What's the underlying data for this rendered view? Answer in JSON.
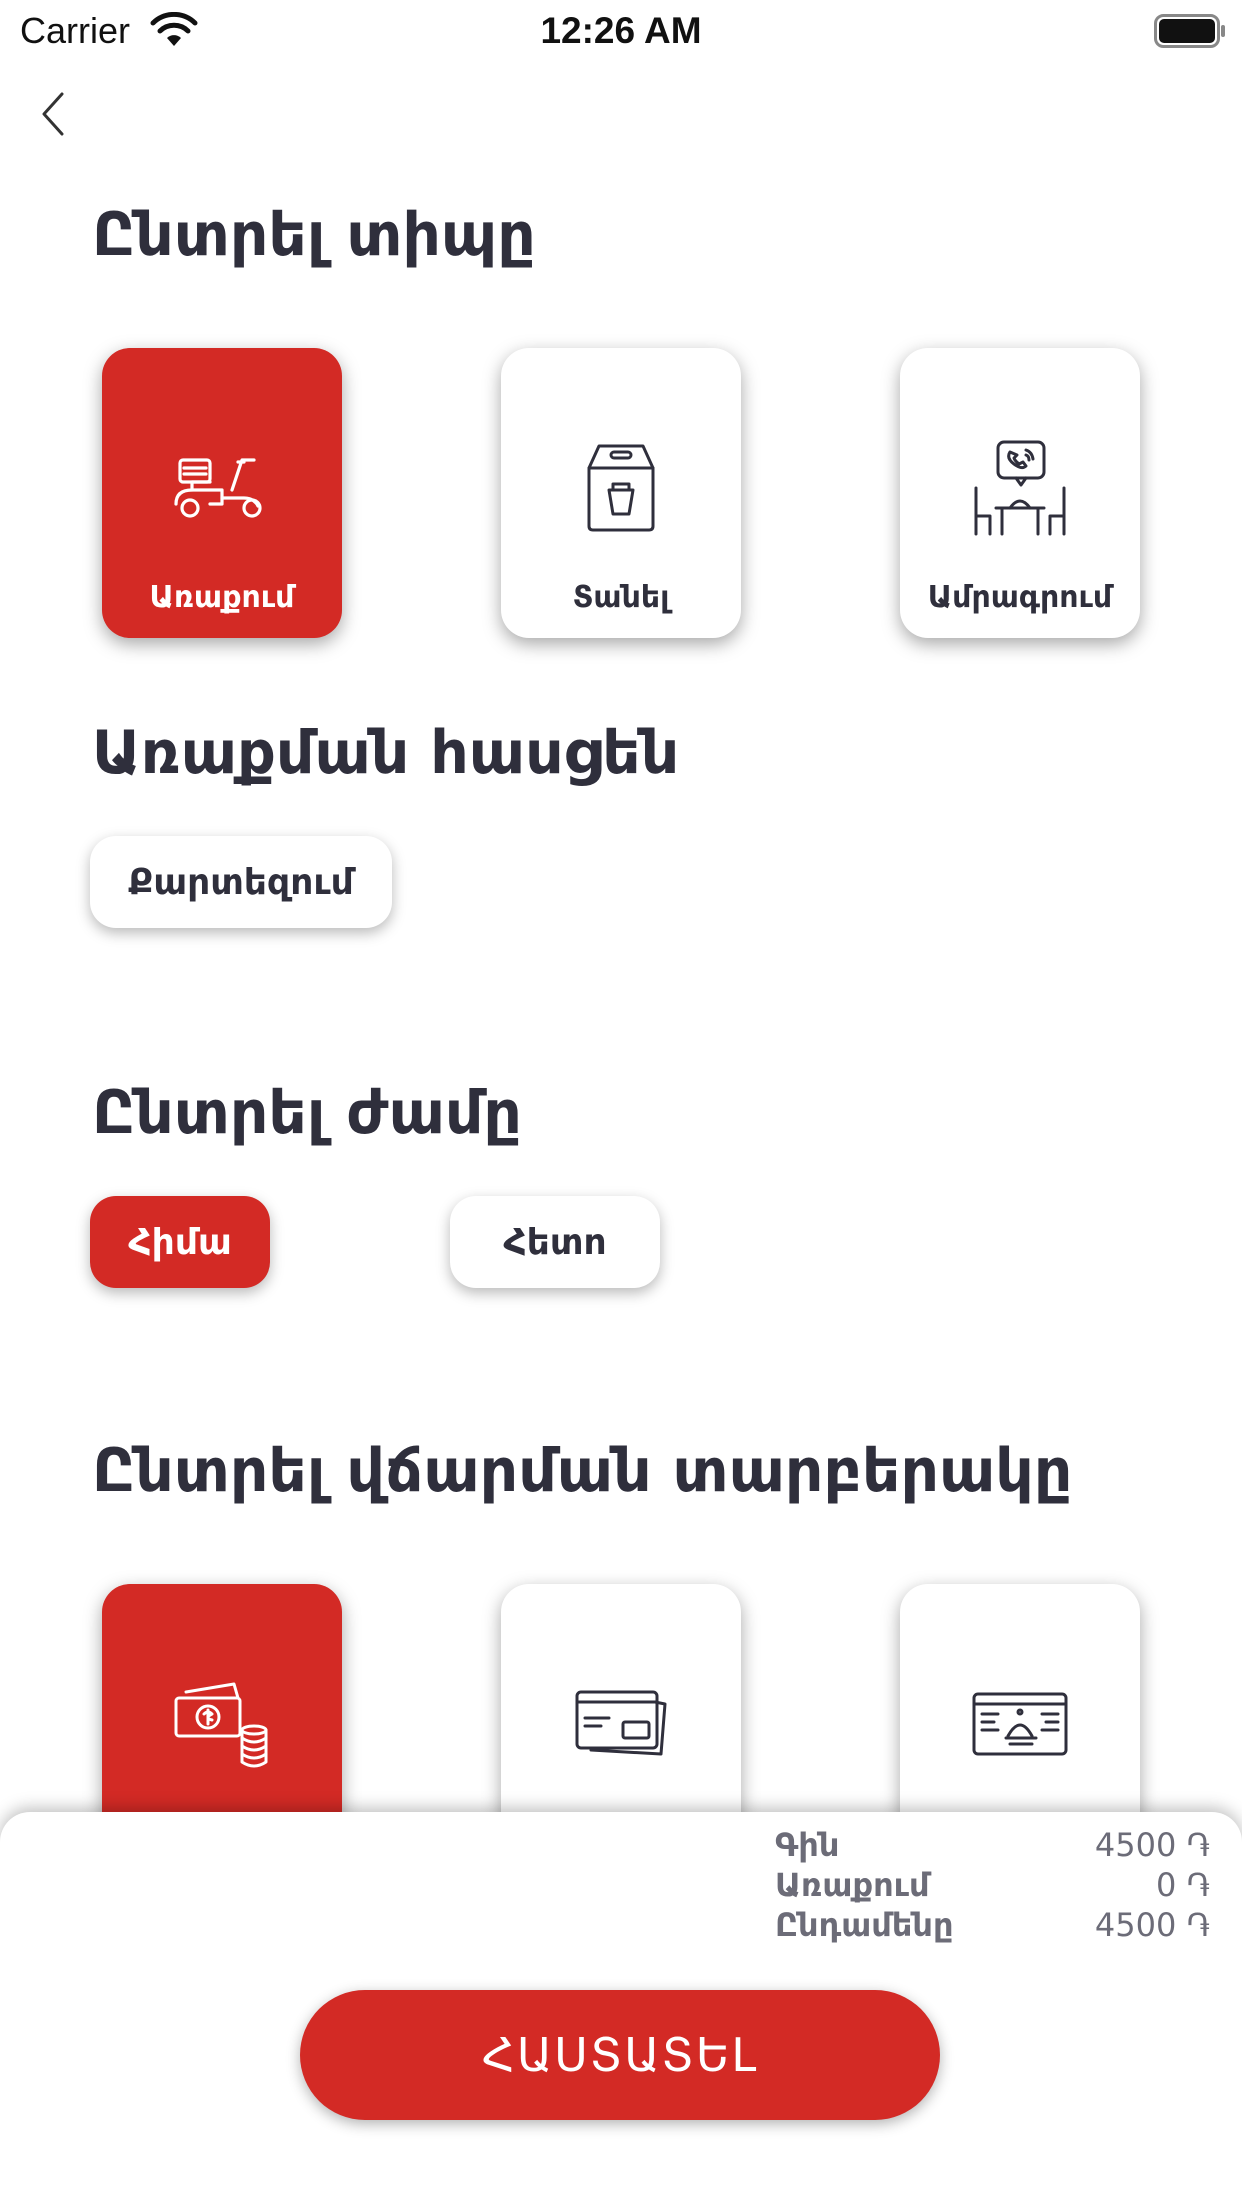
{
  "status_bar": {
    "carrier": "Carrier",
    "time": "12:26 AM"
  },
  "sections": {
    "type_title": "Ընտրել տիպը",
    "address_title": "Առաքման հասցեն",
    "time_title": "Ընտրել ժամը",
    "payment_title": "Ընտրել վճարման տարբերակը"
  },
  "order_types": [
    {
      "label": "Առաքում",
      "icon": "delivery-scooter-icon",
      "selected": true
    },
    {
      "label": "Տանել",
      "icon": "takeaway-bag-icon",
      "selected": false
    },
    {
      "label": "Ամրագրում",
      "icon": "table-reservation-icon",
      "selected": false
    }
  ],
  "address": {
    "button_label": "Քարտեզում"
  },
  "time_options": [
    {
      "label": "Հիմա",
      "selected": true
    },
    {
      "label": "Հետո",
      "selected": false
    }
  ],
  "payment_methods": [
    {
      "icon": "cash-icon",
      "selected": true
    },
    {
      "icon": "credit-card-icon",
      "selected": false
    },
    {
      "icon": "restaurant-card-icon",
      "selected": false
    }
  ],
  "summary": {
    "rows": [
      {
        "label": "Գին",
        "value": "4500 ֏"
      },
      {
        "label": "Առաքում",
        "value": "0 ֏"
      },
      {
        "label": "Ընդամենը",
        "value": "4500 ֏"
      }
    ],
    "confirm_label": "ՀԱՍՏԱՏԵԼ"
  },
  "colors": {
    "accent": "#d32a25",
    "text": "#2f2f3c",
    "muted": "#6c6c78"
  }
}
